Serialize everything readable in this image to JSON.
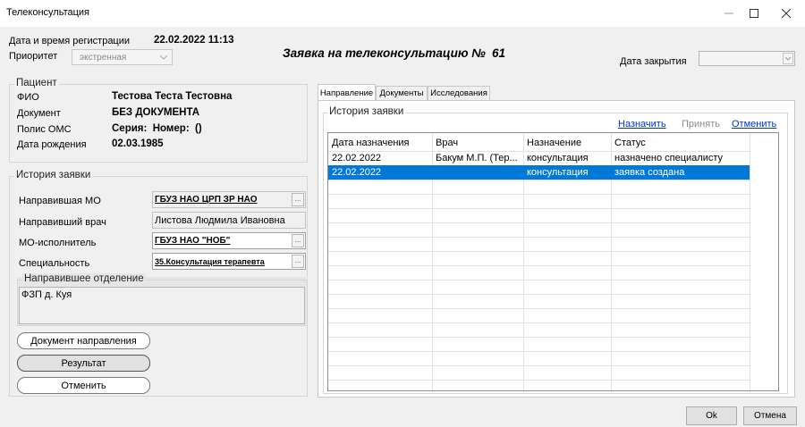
{
  "window": {
    "title": "Телеконсультация"
  },
  "header": {
    "reg_label": "Дата и время регистрации",
    "reg_value": "22.02.2022 11:13",
    "priority_label": "Приоритет",
    "priority_value": "экстренная",
    "request_title": "Заявка на телеконсультацию №",
    "request_number": "61",
    "close_date_label": "Дата закрытия",
    "close_date_value": ""
  },
  "patient": {
    "legend": "Пациент",
    "rows": [
      {
        "label": "ФИО",
        "value": "Тестова Теста Тестовна"
      },
      {
        "label": "Документ",
        "value": "БЕЗ ДОКУМЕНТА"
      },
      {
        "label": "Полис ОМС",
        "value": "Серия:  Номер:  ()"
      },
      {
        "label": "Дата рождения",
        "value": "02.03.1985"
      }
    ]
  },
  "history_left": {
    "legend": "История заявки",
    "referring_mo_label": "Направившая МО",
    "referring_mo_value": "ГБУЗ НАО ЦРП ЗР НАО",
    "referring_doctor_label": "Направивший врач",
    "referring_doctor_value": "Листова Людмила Ивановна",
    "executor_mo_label": "МО-исполнитель",
    "executor_mo_value": "ГБУЗ НАО \"НОБ\"",
    "specialty_label": "Специальность",
    "specialty_value": "35.Консультация терапевта",
    "department_legend": "Направившее отделение",
    "department_value": "ФЗП д. Куя",
    "btn_referral_doc": "Документ направления",
    "btn_result": "Результат",
    "btn_cancel": "Отменить",
    "ellipsis": "..."
  },
  "tabs": [
    {
      "label": "Направление",
      "active": true
    },
    {
      "label": "Документы",
      "active": false
    },
    {
      "label": "Исследования",
      "active": false
    }
  ],
  "history_panel": {
    "legend": "История заявки",
    "link_assign": "Назначить",
    "link_accept": "Принять",
    "link_cancel": "Отменить",
    "columns": [
      "Дата назначения",
      "Врач",
      "Назначение",
      "Статус"
    ],
    "rows": [
      [
        "22.02.2022",
        "Бакум М.П. (Тер...",
        "консультация",
        "назначено специалисту"
      ],
      [
        "22.02.2022",
        "",
        "консультация",
        "заявка создана"
      ]
    ],
    "selected_row": 1,
    "selection_color": "#0078d7"
  },
  "footer": {
    "ok": "Ok",
    "cancel": "Отмена"
  }
}
